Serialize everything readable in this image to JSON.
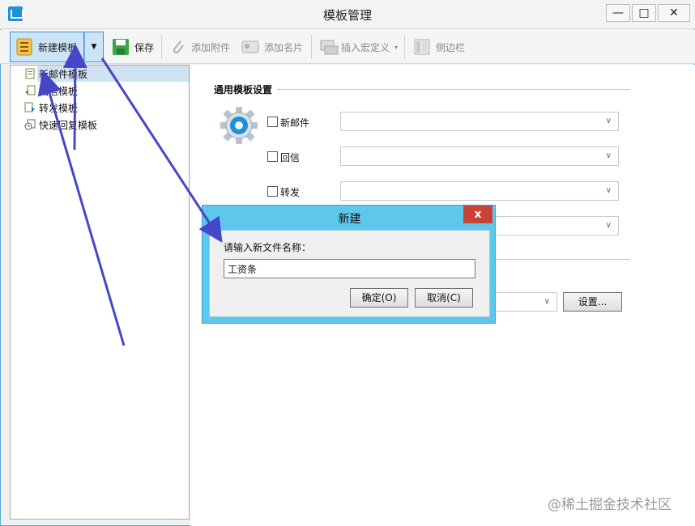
{
  "window": {
    "title": "模板管理",
    "controls": {
      "minimize": "—",
      "maximize": "□",
      "close": "✕"
    }
  },
  "toolbar": {
    "new_template": "新建模板",
    "save": "保存",
    "add_attachment": "添加附件",
    "add_card": "添加名片",
    "insert_macro": "插入宏定义",
    "sidebar": "侧边栏"
  },
  "tree": {
    "items": [
      "新邮件模板",
      "回信模板",
      "转发模板",
      "快速回复模板"
    ],
    "selected_index": 0
  },
  "settings": {
    "section_title": "通用模板设置",
    "rows": [
      {
        "label": "新邮件",
        "checked": false
      },
      {
        "label": "回信",
        "checked": false
      },
      {
        "label": "转发",
        "checked": false
      }
    ],
    "settings_button": "设置..."
  },
  "dialog": {
    "title": "新建",
    "prompt": "请输入新文件名称：",
    "input_value": "工资条",
    "ok": "确定(O)",
    "cancel": "取消(C)",
    "close": "x"
  },
  "watermark": "@稀土掘金技术社区",
  "colors": {
    "accent_blue": "#3a8fd6",
    "dialog_frame": "#5ec7ec",
    "close_red": "#c94236",
    "annotation_arrow": "#4646c8"
  }
}
